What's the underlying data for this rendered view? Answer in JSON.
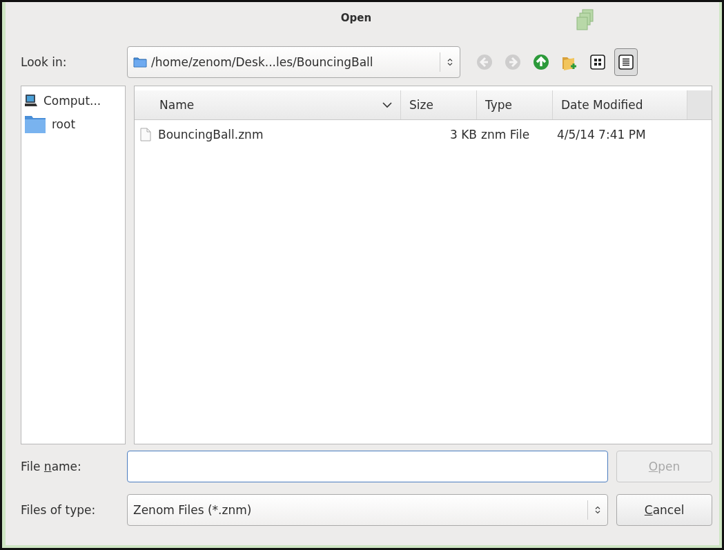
{
  "window": {
    "title": "Open"
  },
  "look_in": {
    "label": "Look in:",
    "path": "/home/zenom/Desk...les/BouncingBall"
  },
  "toolbar": [
    {
      "kind": "back",
      "disabled": true,
      "selected": false
    },
    {
      "kind": "forward",
      "disabled": true,
      "selected": false
    },
    {
      "kind": "up",
      "disabled": false,
      "selected": false
    },
    {
      "kind": "new-folder",
      "disabled": false,
      "selected": false
    },
    {
      "kind": "icon-view",
      "disabled": false,
      "selected": false
    },
    {
      "kind": "list-view",
      "disabled": false,
      "selected": true
    }
  ],
  "sidebar": {
    "items": [
      {
        "kind": "computer",
        "label": "Comput...",
        "selected": false
      },
      {
        "kind": "folder",
        "label": "root",
        "selected": false
      }
    ]
  },
  "table": {
    "columns": [
      {
        "label": "Name",
        "sorted": true
      },
      {
        "label": "Size",
        "sorted": false
      },
      {
        "label": "Type",
        "sorted": false
      },
      {
        "label": "Date Modified",
        "sorted": false
      }
    ],
    "rows": [
      {
        "name": "BouncingBall.znm",
        "size": "3 KB",
        "type": "znm File",
        "date": "4/5/14 7:41 PM",
        "selected": false
      }
    ]
  },
  "file_name": {
    "label": {
      "before": "File ",
      "key": "n",
      "after": "ame:"
    }
  },
  "file_type": {
    "label": "Files of type:",
    "value": "Zenom Files (*.znm)"
  },
  "buttons": [
    {
      "key": "O",
      "after": "pen",
      "disabled": true
    },
    {
      "key": "C",
      "after": "ancel",
      "disabled": false
    }
  ]
}
